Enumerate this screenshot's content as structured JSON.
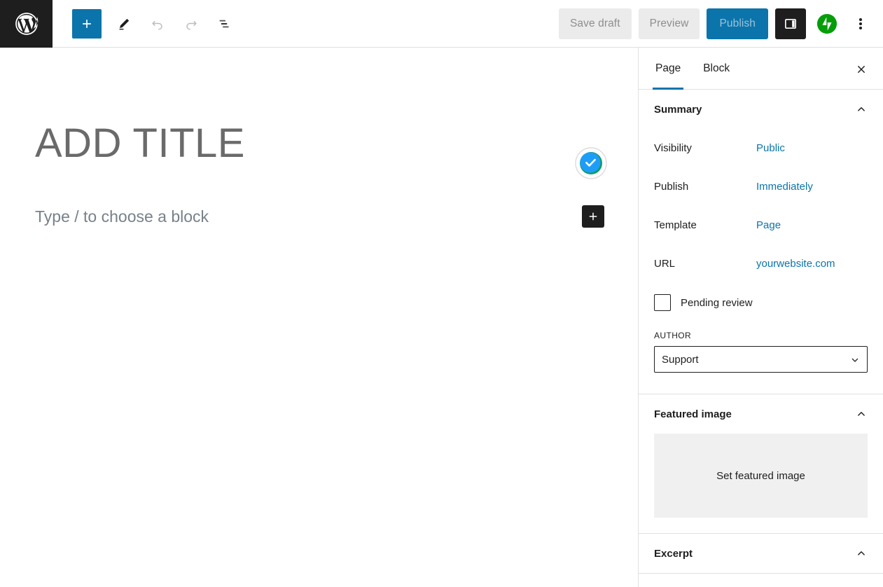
{
  "topbar": {
    "logo_icon": "wordpress-logo-icon",
    "inserter_label": "Toggle block inserter",
    "inserter_icon": "plus-icon",
    "edit_icon": "pencil-icon",
    "undo_icon": "undo-arrow-icon",
    "redo_icon": "redo-arrow-icon",
    "details_icon": "document-overview-icon",
    "save_draft_label": "Save draft",
    "preview_label": "Preview",
    "publish_label": "Publish",
    "sidebar_toggle_icon": "settings-panel-icon",
    "jetpack_icon": "jetpack-logo-icon",
    "more_icon": "ellipsis-vertical-icon"
  },
  "canvas": {
    "title": "ADD TITLE",
    "block_placeholder": "Type / to choose a block",
    "check_badge_icon": "checkmark-circle-icon",
    "block_inserter_icon": "plus-icon"
  },
  "sidebar": {
    "tabs": [
      {
        "label": "Page",
        "active": true
      },
      {
        "label": "Block",
        "active": false
      }
    ],
    "close_icon": "close-icon",
    "summary": {
      "title": "Summary",
      "collapse_icon": "chevron-up-icon",
      "rows": [
        {
          "label": "Visibility",
          "value": "Public"
        },
        {
          "label": "Publish",
          "value": "Immediately"
        },
        {
          "label": "Template",
          "value": "Page"
        },
        {
          "label": "URL",
          "value": "yourwebsite.com"
        }
      ],
      "pending_review_label": "Pending review",
      "pending_review_checked": false,
      "author_label": "AUTHOR",
      "author_value": "Support",
      "author_options": [
        "Support"
      ]
    },
    "featured_image": {
      "title": "Featured image",
      "collapse_icon": "chevron-up-icon",
      "set_label": "Set featured image"
    },
    "excerpt": {
      "title": "Excerpt",
      "collapse_icon": "chevron-up-icon"
    }
  },
  "colors": {
    "accent_blue": "#0b74ab",
    "dark": "#1e1e1e",
    "jetpack_green": "#069e08",
    "check_blue": "#1e9df8",
    "check_ring_green": "#0a9e5a",
    "border": "#e0e0e0",
    "muted_text": "#8e8e8e"
  }
}
